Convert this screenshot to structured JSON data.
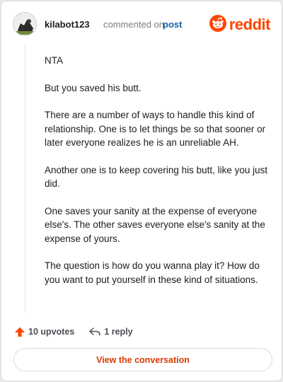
{
  "header": {
    "username": "kilabot123",
    "commented_text": "commented on",
    "post_link": "post",
    "brand": "reddit"
  },
  "comment": {
    "paragraphs": [
      "NTA",
      "But you saved his butt.",
      "There are a number of ways to handle this kind of relationship. One is to let things be so that sooner or later everyone realizes he is an unreliable AH.",
      "Another one is to keep covering his butt, like you just did.",
      "One saves your sanity at the expense of everyone else's. The other saves everyone else's sanity at the expense of yours.",
      "The question is how do you wanna play it? How do you want to put yourself in these kind of situations."
    ]
  },
  "actions": {
    "upvotes": "10 upvotes",
    "reply": "1 reply"
  },
  "cta": {
    "label": "View the conversation"
  },
  "colors": {
    "brand": "#ff4500",
    "link": "#1a5fa8",
    "cta_text": "#d93a00"
  }
}
